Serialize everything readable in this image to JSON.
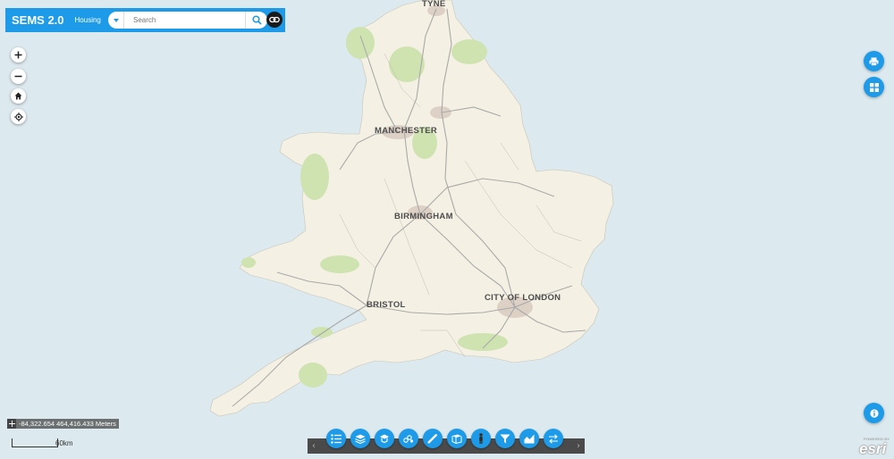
{
  "header": {
    "app_title": "SEMS 2.0",
    "app_subtitle": "Housing",
    "search_placeholder": "Search",
    "search_icon": "search-icon",
    "dropdown_icon": "caret-down-icon",
    "link_icon": "link-icon"
  },
  "map": {
    "labels": [
      "TYNE",
      "MANCHESTER",
      "BIRMINGHAM",
      "BRISTOL",
      "CITY OF LONDON"
    ],
    "colors": {
      "sea": "#dce9ee",
      "land": "#f4f1e4",
      "park": "#cfe3b0",
      "urban": "#ddd1c6",
      "road": "#a9a9a9"
    }
  },
  "map_controls": {
    "zoom_in_icon": "plus-icon",
    "zoom_out_icon": "minus-icon",
    "home_icon": "home-icon",
    "locate_icon": "locate-icon"
  },
  "right_controls": {
    "print_icon": "print-icon",
    "basemap_icon": "grid-icon",
    "info_icon": "info-icon"
  },
  "status": {
    "coordinates": "-84,322.654 464,416.433 Meters",
    "scale_label": "60km"
  },
  "toolbar": {
    "prev_icon": "chevron-left-icon",
    "next_icon": "chevron-right-icon",
    "tools": [
      "list-icon",
      "layers-icon",
      "query-icon",
      "analysis-icon",
      "measure-icon",
      "print-layout-icon",
      "person-icon",
      "filter-icon",
      "chart-icon",
      "swap-icon"
    ]
  },
  "attribution": {
    "powered_by": "POWERED BY",
    "logo_text": "esri"
  }
}
